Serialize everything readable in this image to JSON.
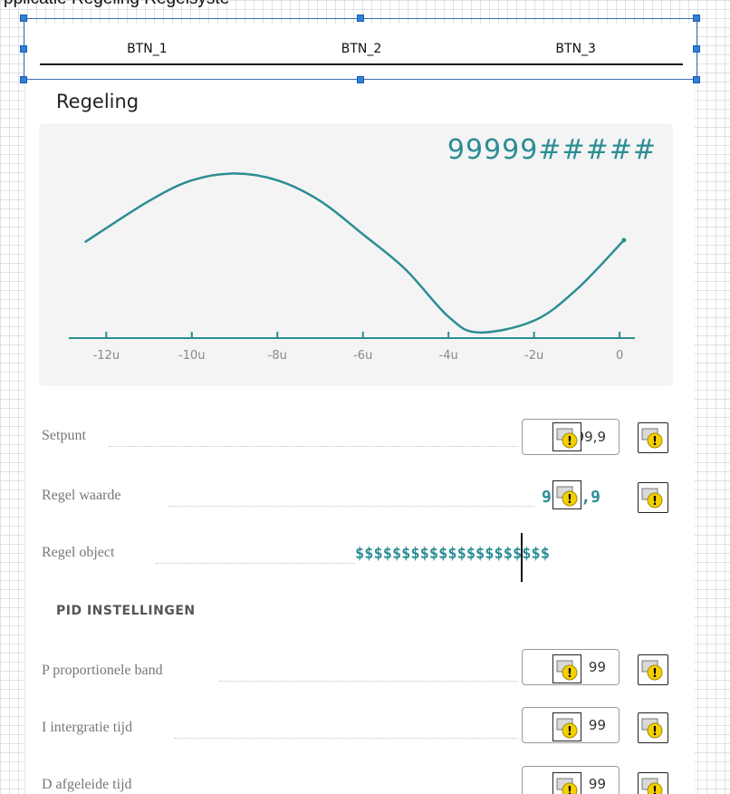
{
  "caption": "pplicatie Regeling Regelsyste",
  "nav": {
    "buttons": [
      "BTN_1",
      "BTN_2",
      "BTN_3"
    ]
  },
  "section": {
    "title": "Regeling"
  },
  "chart_data": {
    "type": "line",
    "title": "99999#####",
    "x": [
      -12.5,
      -11,
      -10,
      -9,
      -8,
      -7,
      -6,
      -5,
      -4,
      -3.3,
      -2,
      -1,
      0.1
    ],
    "values": [
      0.3,
      0.72,
      0.93,
      1.0,
      0.93,
      0.72,
      0.38,
      0.02,
      -0.46,
      -0.62,
      -0.5,
      -0.18,
      0.32
    ],
    "xticks": [
      "-12u",
      "-10u",
      "-8u",
      "-6u",
      "-4u",
      "-2u",
      "0"
    ],
    "xtick_values": [
      -12,
      -10,
      -8,
      -6,
      -4,
      -2,
      0
    ],
    "xlim": [
      -12.6,
      0.4
    ],
    "ylim": [
      -0.65,
      1.05
    ],
    "color": "#2c8d94",
    "grid": false
  },
  "rows": {
    "setpunt": {
      "label": "Setpunt",
      "value": "99,9"
    },
    "regel_waarde": {
      "label": "Regel waarde",
      "value": "9999,9"
    },
    "regel_object": {
      "label": "Regel object",
      "value": "$$$$$$$$$$$$$$$$$$$$$"
    }
  },
  "pid": {
    "heading": "PID INSTELLINGEN",
    "p": {
      "label": "P proportionele band",
      "value": "99"
    },
    "i": {
      "label": "I intergratie tijd",
      "value": "99"
    },
    "d": {
      "label": "D afgeleide tijd",
      "value": "99"
    }
  },
  "colors": {
    "accent": "#2c8d94",
    "selection": "#2f80d6"
  },
  "icons": {
    "broken_image": "broken-image-warning-icon"
  }
}
